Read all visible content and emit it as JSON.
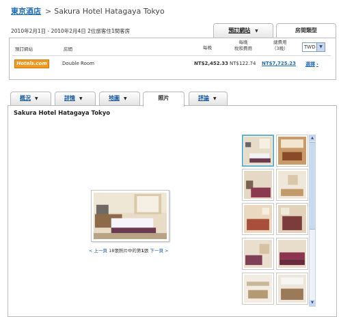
{
  "breadcrumb": {
    "city": "東京酒店",
    "separator": ">",
    "hotel": "Sakura Hotel Hatagaya Tokyo"
  },
  "stay_summary": "2010年2月1日 - 2010年2月4日  2位旅客住1間客房",
  "top_tabs": [
    {
      "label": "預訂網站",
      "selected": false
    },
    {
      "label": "房間類型",
      "selected": true
    }
  ],
  "price_table": {
    "headers": {
      "site": "預訂網站",
      "room": "房間",
      "per_night": "每晚",
      "tax_line1": "每晚",
      "tax_line2": "稅和費用",
      "total_line1": "總費用",
      "total_line2": "（3晚）"
    },
    "currency": "TWD",
    "rows": [
      {
        "site_logo": "Hotels.com",
        "room": "Double Room",
        "per_night": "NT$2,452.33",
        "tax": "NT$122.74",
        "total": "NT$7,725.23",
        "action": "選擇"
      }
    ]
  },
  "section_tabs": [
    {
      "label": "概況",
      "selected": false,
      "dropdown": true
    },
    {
      "label": "詳情",
      "selected": false,
      "dropdown": true
    },
    {
      "label": "地圖",
      "selected": false,
      "dropdown": true
    },
    {
      "label": "照片",
      "selected": true,
      "dropdown": false
    },
    {
      "label": "評論",
      "selected": false,
      "dropdown": true
    }
  ],
  "content_title": "Sakura Hotel Hatagaya Tokyo",
  "pager": {
    "prev": "< 上一頁",
    "text_before": "18張照片中的第",
    "index": "1",
    "text_after": "張",
    "next": "下一頁 >"
  },
  "colors": {
    "link": "#1a5a9e",
    "accent_border": "#5fb2c9",
    "logo_orange": "#f39a1e"
  }
}
